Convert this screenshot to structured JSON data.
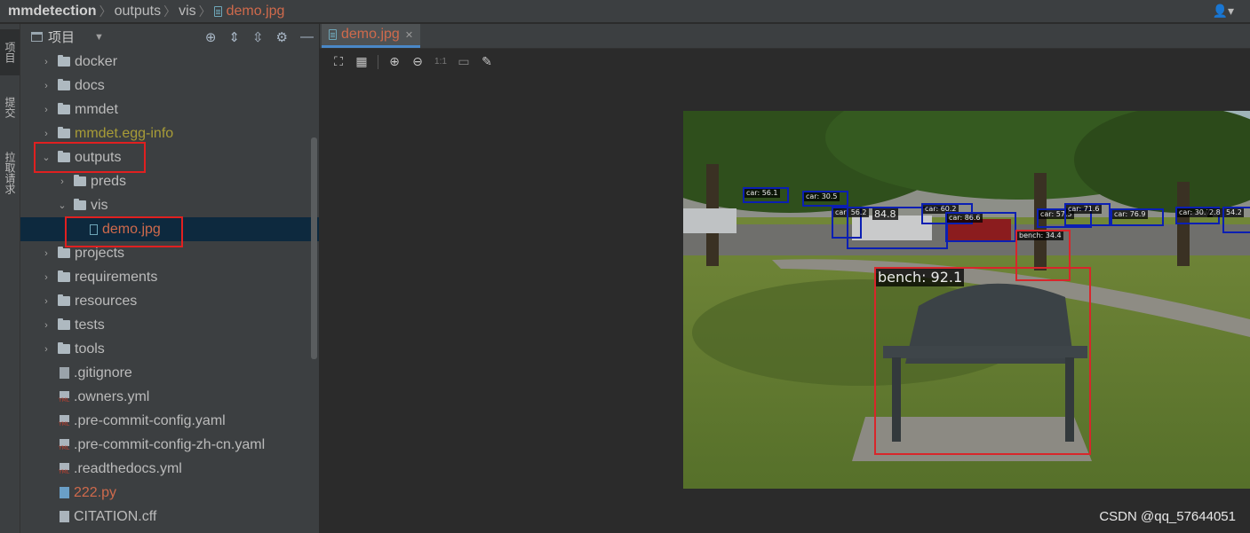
{
  "breadcrumb": [
    "mmdetection",
    "outputs",
    "vis",
    "demo.jpg"
  ],
  "user_menu": "👤▾",
  "left_strip": {
    "tab1": "项目",
    "tab2": "提交",
    "tab3": "拉取请求"
  },
  "project_panel": {
    "title": "项目"
  },
  "tree": [
    {
      "label": "docker"
    },
    {
      "label": "docs"
    },
    {
      "label": "mmdet"
    },
    {
      "label": "mmdet.egg-info"
    },
    {
      "label": "outputs"
    },
    {
      "label": "preds"
    },
    {
      "label": "vis"
    },
    {
      "label": "demo.jpg"
    },
    {
      "label": "projects"
    },
    {
      "label": "requirements"
    },
    {
      "label": "resources"
    },
    {
      "label": "tests"
    },
    {
      "label": "tools"
    },
    {
      "label": ".gitignore"
    },
    {
      "label": ".owners.yml"
    },
    {
      "label": ".pre-commit-config.yaml"
    },
    {
      "label": ".pre-commit-config-zh-cn.yaml"
    },
    {
      "label": ".readthedocs.yml"
    },
    {
      "label": "222.py"
    },
    {
      "label": "CITATION.cff"
    }
  ],
  "editor": {
    "tab_label": "demo.jpg",
    "zoom_1to1": "1:1"
  },
  "detections": [
    {
      "label": "car: 56.1"
    },
    {
      "label": "car: 30.5"
    },
    {
      "label": "car: 56.2"
    },
    {
      "label": "84.8"
    },
    {
      "label": "car: 60.2"
    },
    {
      "label": "car: 86.6"
    },
    {
      "label": "car: 57.5"
    },
    {
      "label": "car: 71.6"
    },
    {
      "label": "car: 76.9"
    },
    {
      "label": "car: 30.7"
    },
    {
      "label": "2.8"
    },
    {
      "label": "54.2"
    },
    {
      "label": "bench: 34.4"
    },
    {
      "label": "bench: 92.1"
    }
  ],
  "watermark": "CSDN @qq_57644051",
  "colors": {
    "car_box": "#0b1fb3",
    "bench_box": "#d8262b",
    "highlight": "#e02020",
    "modified_file": "#cf6a4c"
  }
}
